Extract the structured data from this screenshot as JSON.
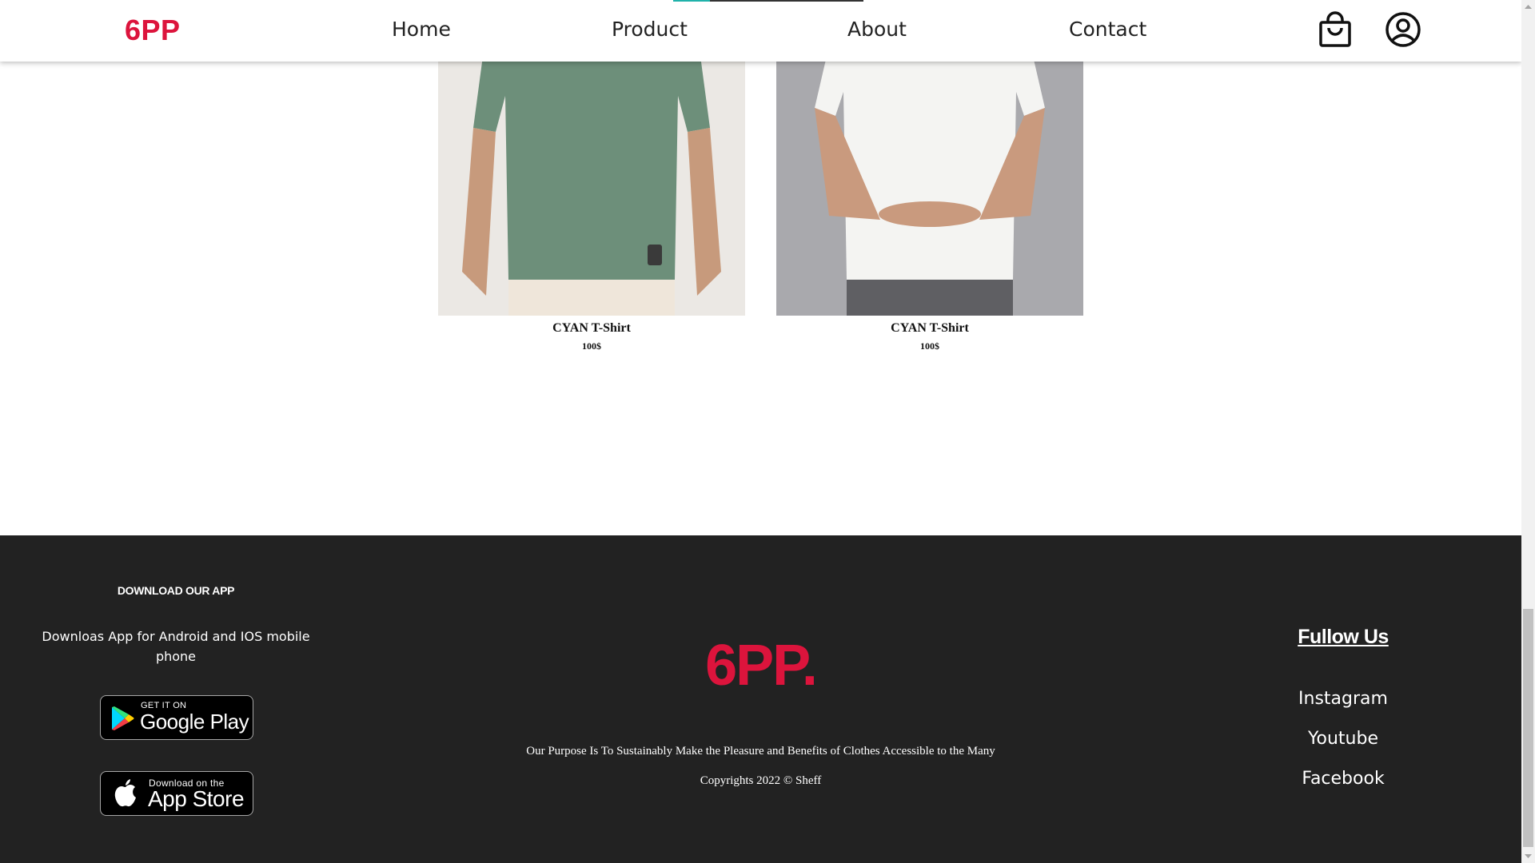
{
  "header": {
    "brand": "6PP",
    "nav": [
      "Home",
      "Product",
      "About",
      "Contact"
    ],
    "icons": [
      "shopping-bag-icon",
      "user-circle-icon"
    ],
    "accent": "#dc143c"
  },
  "products": [
    {
      "name": "CYAN T-Shirt",
      "price": "100$",
      "shirt_color": "#6d8f7a"
    },
    {
      "name": "CYAN T-Shirt",
      "price": "100$",
      "shirt_color": "#f4f4f2"
    }
  ],
  "footer": {
    "app_heading": "DOWNLOAD OUR APP",
    "app_description": "Downloas App for Android and IOS mobile phone",
    "google_play": {
      "small": "GET IT ON",
      "big": "Google Play"
    },
    "app_store": {
      "small": "Download on the",
      "big": "App Store"
    },
    "logo": "6PP.",
    "purpose": "Our Purpose Is To Sustainably Make the Pleasure and Benefits of Clothes Accessible to the Many",
    "copyright": "Copyrights 2022 © Sheff",
    "follow_heading": "Fullow Us",
    "social": [
      "Instagram",
      "Youtube",
      "Facebook"
    ],
    "background": "#222222"
  }
}
